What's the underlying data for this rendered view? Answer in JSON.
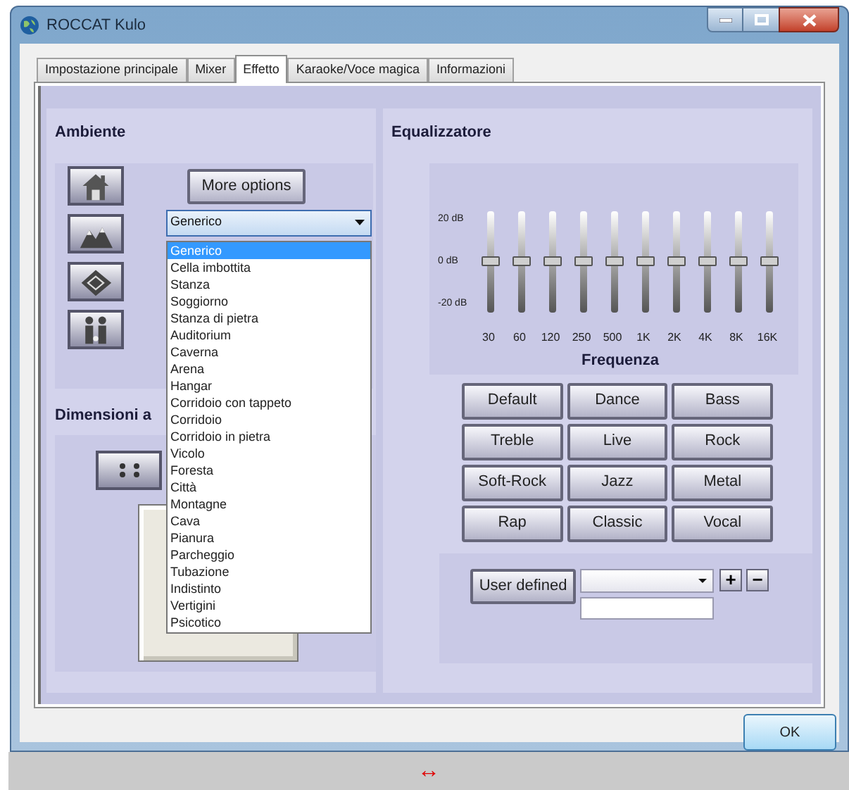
{
  "window": {
    "title": "ROCCAT Kulo"
  },
  "tabs": [
    {
      "label": "Impostazione principale",
      "selected": false
    },
    {
      "label": "Mixer",
      "selected": false
    },
    {
      "label": "Effetto",
      "selected": true
    },
    {
      "label": "Karaoke/Voce magica",
      "selected": false
    },
    {
      "label": "Informazioni",
      "selected": false
    }
  ],
  "ambiente": {
    "heading": "Ambiente",
    "more_options": "More options",
    "combo": {
      "value": "Generico",
      "expanded": true
    },
    "options": [
      {
        "label": "Generico",
        "selected": true
      },
      {
        "label": "Cella imbottita",
        "selected": false
      },
      {
        "label": "Stanza",
        "selected": false
      },
      {
        "label": "Soggiorno",
        "selected": false
      },
      {
        "label": "Stanza di pietra",
        "selected": false
      },
      {
        "label": "Auditorium",
        "selected": false
      },
      {
        "label": "Caverna",
        "selected": false
      },
      {
        "label": "Arena",
        "selected": false
      },
      {
        "label": "Hangar",
        "selected": false
      },
      {
        "label": "Corridoio con tappeto",
        "selected": false
      },
      {
        "label": "Corridoio",
        "selected": false
      },
      {
        "label": "Corridoio in pietra",
        "selected": false
      },
      {
        "label": "Vicolo",
        "selected": false
      },
      {
        "label": "Foresta",
        "selected": false
      },
      {
        "label": "Città",
        "selected": false
      },
      {
        "label": "Montagne",
        "selected": false
      },
      {
        "label": "Cava",
        "selected": false
      },
      {
        "label": "Pianura",
        "selected": false
      },
      {
        "label": "Parcheggio",
        "selected": false
      },
      {
        "label": "Tubazione",
        "selected": false
      },
      {
        "label": "Indistinto",
        "selected": false
      },
      {
        "label": "Vertigini",
        "selected": false
      },
      {
        "label": "Psicotico",
        "selected": false
      }
    ]
  },
  "dimensioni": {
    "heading": "Dimensioni a"
  },
  "equalizer": {
    "heading": "Equalizzatore",
    "db_labels": [
      "20 dB",
      "0 dB",
      "-20 dB"
    ],
    "bands": [
      {
        "label": "30",
        "level": 0.5
      },
      {
        "label": "60",
        "level": 0.5
      },
      {
        "label": "120",
        "level": 0.5
      },
      {
        "label": "250",
        "level": 0.5
      },
      {
        "label": "500",
        "level": 0.5
      },
      {
        "label": "1K",
        "level": 0.5
      },
      {
        "label": "2K",
        "level": 0.5
      },
      {
        "label": "4K",
        "level": 0.5
      },
      {
        "label": "8K",
        "level": 0.5
      },
      {
        "label": "16K",
        "level": 0.5
      }
    ],
    "axis_label": "Frequenza",
    "presets": [
      "Default",
      "Dance",
      "Bass",
      "Treble",
      "Live",
      "Rock",
      "Soft-Rock",
      "Jazz",
      "Metal",
      "Rap",
      "Classic",
      "Vocal"
    ],
    "user_defined": "User defined",
    "add": "+",
    "remove": "−"
  },
  "ok": "OK",
  "footer": {
    "resize": "↔"
  }
}
